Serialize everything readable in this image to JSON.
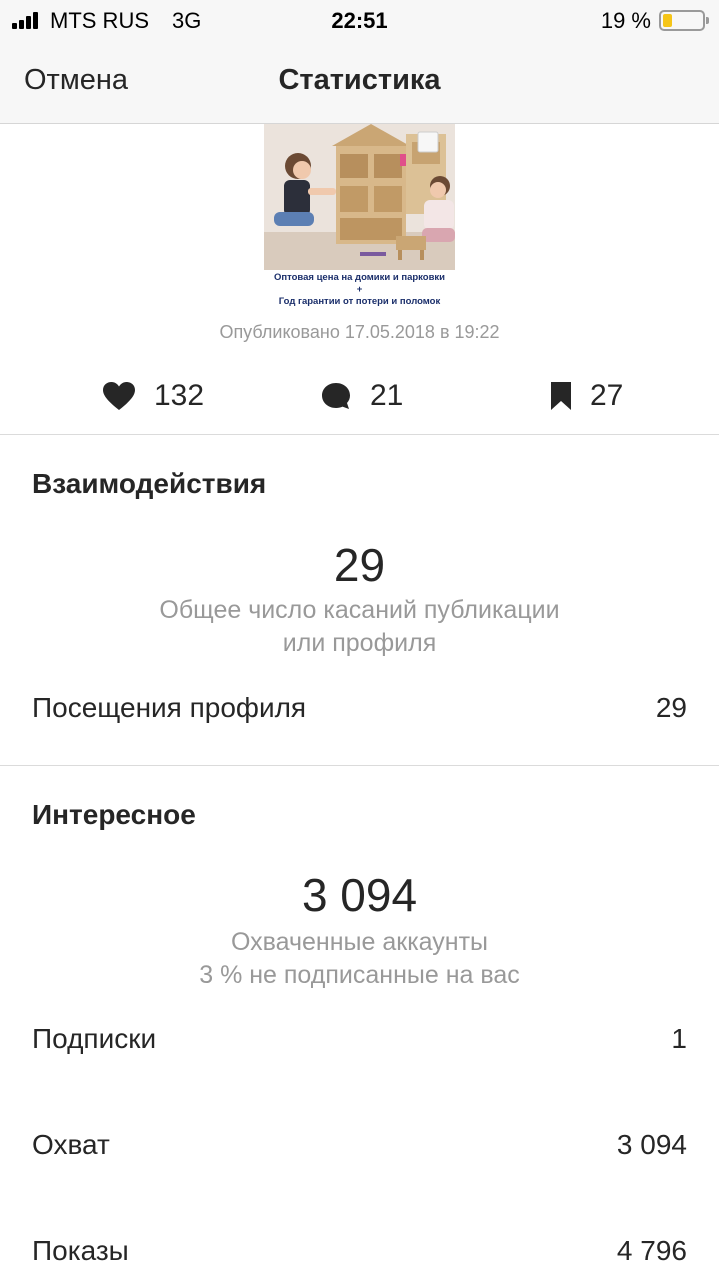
{
  "status_bar": {
    "carrier": "MTS RUS",
    "network": "3G",
    "time": "22:51",
    "battery": "19 %",
    "battery_level": 0.19,
    "battery_color": "#f5c518"
  },
  "nav": {
    "cancel_label": "Отмена",
    "title": "Статистика"
  },
  "post": {
    "caption_line1": "Оптовая цена на домики и парковки",
    "caption_line2": "+",
    "caption_line3": "Год гарантии от потери и поломок",
    "published": "Опубликовано 17.05.2018 в 19:22"
  },
  "stats": {
    "likes": "132",
    "comments": "21",
    "saves": "27",
    "icons": [
      "heart-icon",
      "comment-icon",
      "bookmark-icon"
    ]
  },
  "interactions": {
    "title": "Взаимодействия",
    "total": "29",
    "total_caption_line1": "Общее число касаний публикации",
    "total_caption_line2": "или профиля",
    "rows": [
      {
        "label": "Посещения профиля",
        "value": "29"
      }
    ]
  },
  "discovery": {
    "title": "Интересное",
    "total": "3 094",
    "caption_line1": "Охваченные аккаунты",
    "caption_line2": "3 % не подписанные на вас",
    "rows": [
      {
        "label": "Подписки",
        "value": "1"
      },
      {
        "label": "Охват",
        "value": "3 094"
      },
      {
        "label": "Показы",
        "value": "4 796"
      }
    ]
  }
}
